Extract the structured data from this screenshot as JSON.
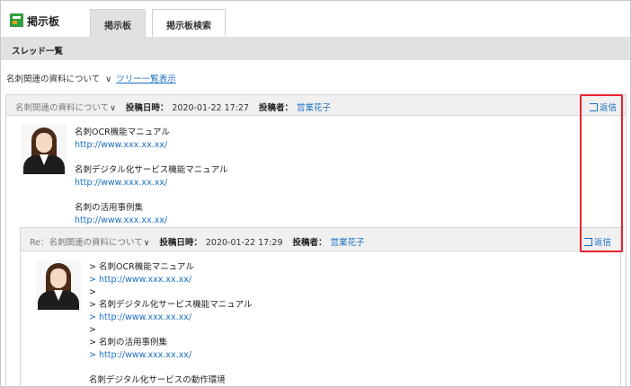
{
  "app": {
    "title": "掲示板",
    "brand_color": "#2e9e3e"
  },
  "tabs": [
    {
      "label": "掲示板",
      "active": true
    },
    {
      "label": "掲示板検索",
      "active": false
    }
  ],
  "section": {
    "title": "スレッド一覧"
  },
  "thread": {
    "title": "名刺関連の資料について",
    "tree_link": "ツリー一覧表示"
  },
  "post1": {
    "subject": "名刺関連の資料について",
    "date_label": "投稿日時：",
    "date": "2020-01-22 17:27",
    "author_label": "投稿者：",
    "author": "営業花子",
    "reply_label": "返信",
    "body": [
      {
        "text": "名刺OCR機能マニュアル",
        "link": "http://www.xxx.xx.xx/"
      },
      {
        "text": "名刺デジタル化サービス機能マニュアル",
        "link": "http://www.xxx.xx.xx/"
      },
      {
        "text": "名刺の活用事例集",
        "link": "http://www.xxx.xx.xx/"
      }
    ]
  },
  "post2": {
    "subject": "Re：名刺関連の資料について",
    "date_label": "投稿日時：",
    "date": "2020-01-22 17:29",
    "author_label": "投稿者：",
    "author": "営業花子",
    "reply_label": "返信",
    "quoted": [
      {
        "text": "> 名刺OCR機能マニュアル",
        "link": "> http://www.xxx.xx.xx/"
      },
      {
        "text": "> 名刺デジタル化サービス機能マニュアル",
        "link": "> http://www.xxx.xx.xx/"
      },
      {
        "text": "> 名刺の活用事例集",
        "link": "> http://www.xxx.xx.xx/"
      }
    ],
    "quote_blank": ">",
    "trailing": "名刺デジタル化サービスの動作環境"
  },
  "colors": {
    "link": "#1a6fc4",
    "highlight": "#e8232e"
  }
}
